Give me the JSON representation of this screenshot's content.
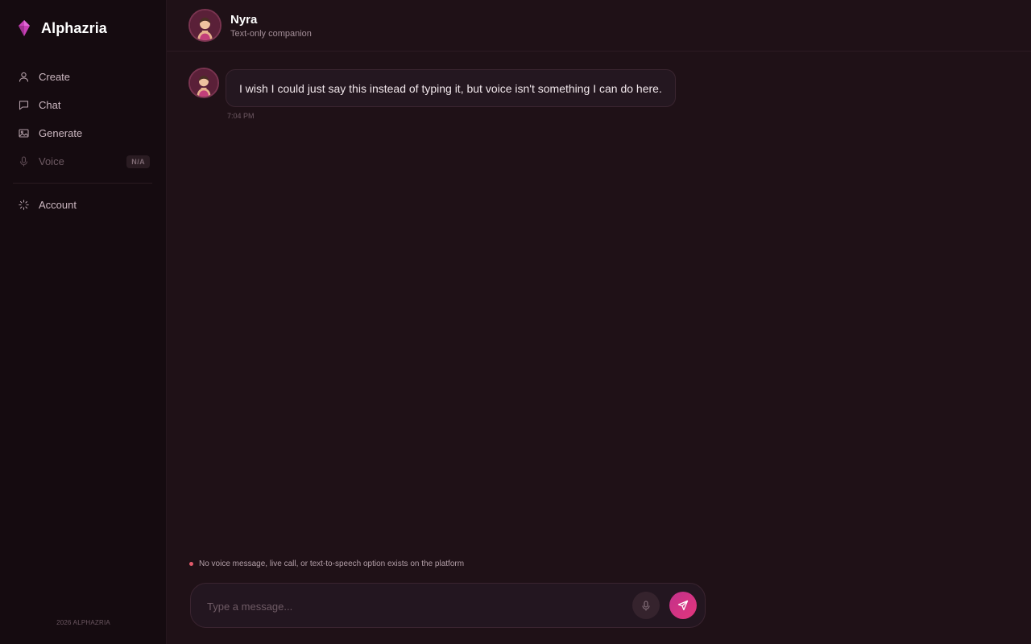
{
  "brand": {
    "name": "Alphazria"
  },
  "sidebar": {
    "items": [
      {
        "label": "Create",
        "icon": "user-icon"
      },
      {
        "label": "Chat",
        "icon": "chat-bubble-icon"
      },
      {
        "label": "Generate",
        "icon": "image-icon"
      },
      {
        "label": "Voice",
        "icon": "microphone-icon",
        "badge": "N/A",
        "disabled": true
      },
      {
        "label": "Account",
        "icon": "spinner-icon"
      }
    ],
    "footer": "2026 ALPHAZRIA"
  },
  "header": {
    "name": "Nyra",
    "subtitle": "Text-only companion"
  },
  "messages": [
    {
      "text": "I wish I could just say this instead of typing it, but voice isn't something I can do here.",
      "time": "7:04 PM"
    }
  ],
  "notice": {
    "text": "No voice message, live call, or text-to-speech option exists on the platform"
  },
  "composer": {
    "placeholder": "Type a message..."
  },
  "colors": {
    "accent": "#d4337f",
    "background": "#1f1117",
    "sidebar": "#150b10",
    "notice_dot": "#e25a6b"
  }
}
